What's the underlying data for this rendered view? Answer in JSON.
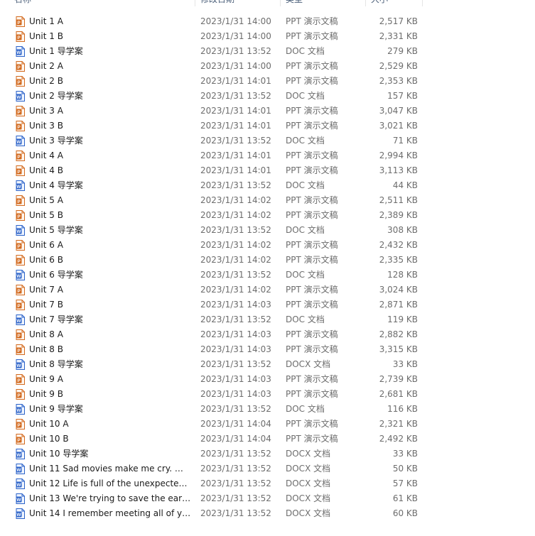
{
  "header": {
    "name": "名称",
    "date": "修改日期",
    "type": "类型",
    "size": "大小"
  },
  "colors": {
    "ppt": "#d2691e",
    "doc": "#2b62c8"
  },
  "files": [
    {
      "name": "Unit 1 A",
      "date": "2023/1/31 14:00",
      "type": "PPT 演示文稿",
      "size": "2,517 KB",
      "icon": "ppt-file-icon"
    },
    {
      "name": "Unit 1 B",
      "date": "2023/1/31 14:00",
      "type": "PPT 演示文稿",
      "size": "2,331 KB",
      "icon": "ppt-file-icon"
    },
    {
      "name": "Unit 1 导学案",
      "date": "2023/1/31 13:52",
      "type": "DOC 文档",
      "size": "279 KB",
      "icon": "word-file-icon"
    },
    {
      "name": "Unit 2 A",
      "date": "2023/1/31 14:00",
      "type": "PPT 演示文稿",
      "size": "2,529 KB",
      "icon": "ppt-file-icon"
    },
    {
      "name": "Unit 2 B",
      "date": "2023/1/31 14:01",
      "type": "PPT 演示文稿",
      "size": "2,353 KB",
      "icon": "ppt-file-icon"
    },
    {
      "name": "Unit 2 导学案",
      "date": "2023/1/31 13:52",
      "type": "DOC 文档",
      "size": "157 KB",
      "icon": "word-file-icon"
    },
    {
      "name": "Unit 3 A",
      "date": "2023/1/31 14:01",
      "type": "PPT 演示文稿",
      "size": "3,047 KB",
      "icon": "ppt-file-icon"
    },
    {
      "name": "Unit 3 B",
      "date": "2023/1/31 14:01",
      "type": "PPT 演示文稿",
      "size": "3,021 KB",
      "icon": "ppt-file-icon"
    },
    {
      "name": "Unit 3 导学案",
      "date": "2023/1/31 13:52",
      "type": "DOC 文档",
      "size": "71 KB",
      "icon": "word-file-icon"
    },
    {
      "name": "Unit 4 A",
      "date": "2023/1/31 14:01",
      "type": "PPT 演示文稿",
      "size": "2,994 KB",
      "icon": "ppt-file-icon"
    },
    {
      "name": "Unit 4 B",
      "date": "2023/1/31 14:01",
      "type": "PPT 演示文稿",
      "size": "3,113 KB",
      "icon": "ppt-file-icon"
    },
    {
      "name": "Unit 4 导学案",
      "date": "2023/1/31 13:52",
      "type": "DOC 文档",
      "size": "44 KB",
      "icon": "word-file-icon"
    },
    {
      "name": "Unit 5 A",
      "date": "2023/1/31 14:02",
      "type": "PPT 演示文稿",
      "size": "2,511 KB",
      "icon": "ppt-file-icon"
    },
    {
      "name": "Unit 5 B",
      "date": "2023/1/31 14:02",
      "type": "PPT 演示文稿",
      "size": "2,389 KB",
      "icon": "ppt-file-icon"
    },
    {
      "name": "Unit 5 导学案",
      "date": "2023/1/31 13:52",
      "type": "DOC 文档",
      "size": "308 KB",
      "icon": "word-file-icon"
    },
    {
      "name": "Unit 6 A",
      "date": "2023/1/31 14:02",
      "type": "PPT 演示文稿",
      "size": "2,432 KB",
      "icon": "ppt-file-icon"
    },
    {
      "name": "Unit 6 B",
      "date": "2023/1/31 14:02",
      "type": "PPT 演示文稿",
      "size": "2,335 KB",
      "icon": "ppt-file-icon"
    },
    {
      "name": "Unit 6 导学案",
      "date": "2023/1/31 13:52",
      "type": "DOC 文档",
      "size": "128 KB",
      "icon": "word-file-icon"
    },
    {
      "name": "Unit 7 A",
      "date": "2023/1/31 14:02",
      "type": "PPT 演示文稿",
      "size": "3,024 KB",
      "icon": "ppt-file-icon"
    },
    {
      "name": "Unit 7 B",
      "date": "2023/1/31 14:03",
      "type": "PPT 演示文稿",
      "size": "2,871 KB",
      "icon": "ppt-file-icon"
    },
    {
      "name": "Unit 7 导学案",
      "date": "2023/1/31 13:52",
      "type": "DOC 文档",
      "size": "119 KB",
      "icon": "word-file-icon"
    },
    {
      "name": "Unit 8 A",
      "date": "2023/1/31 14:03",
      "type": "PPT 演示文稿",
      "size": "2,882 KB",
      "icon": "ppt-file-icon"
    },
    {
      "name": "Unit 8 B",
      "date": "2023/1/31 14:03",
      "type": "PPT 演示文稿",
      "size": "3,315 KB",
      "icon": "ppt-file-icon"
    },
    {
      "name": "Unit 8 导学案",
      "date": "2023/1/31 13:52",
      "type": "DOCX 文档",
      "size": "33 KB",
      "icon": "word-file-icon"
    },
    {
      "name": "Unit 9 A",
      "date": "2023/1/31 14:03",
      "type": "PPT 演示文稿",
      "size": "2,739 KB",
      "icon": "ppt-file-icon"
    },
    {
      "name": "Unit 9 B",
      "date": "2023/1/31 14:03",
      "type": "PPT 演示文稿",
      "size": "2,681 KB",
      "icon": "ppt-file-icon"
    },
    {
      "name": "Unit 9 导学案",
      "date": "2023/1/31 13:52",
      "type": "DOC 文档",
      "size": "116 KB",
      "icon": "word-file-icon"
    },
    {
      "name": "Unit 10  A",
      "date": "2023/1/31 14:04",
      "type": "PPT 演示文稿",
      "size": "2,321 KB",
      "icon": "ppt-file-icon"
    },
    {
      "name": "Unit 10  B",
      "date": "2023/1/31 14:04",
      "type": "PPT 演示文稿",
      "size": "2,492 KB",
      "icon": "ppt-file-icon"
    },
    {
      "name": "Unit 10 导学案",
      "date": "2023/1/31 13:52",
      "type": "DOCX 文档",
      "size": "33 KB",
      "icon": "word-file-icon"
    },
    {
      "name": "Unit 11 Sad movies make me cry. 导...",
      "date": "2023/1/31 13:52",
      "type": "DOCX 文档",
      "size": "50 KB",
      "icon": "word-file-icon"
    },
    {
      "name": "Unit 12 Life is full of the unexpected. ...",
      "date": "2023/1/31 13:52",
      "type": "DOCX 文档",
      "size": "57 KB",
      "icon": "word-file-icon"
    },
    {
      "name": "Unit 13 We're trying to save the eart...",
      "date": "2023/1/31 13:52",
      "type": "DOCX 文档",
      "size": "61 KB",
      "icon": "word-file-icon"
    },
    {
      "name": "Unit 14 I remember meeting all of yo...",
      "date": "2023/1/31 13:52",
      "type": "DOCX 文档",
      "size": "60 KB",
      "icon": "word-file-icon"
    }
  ]
}
